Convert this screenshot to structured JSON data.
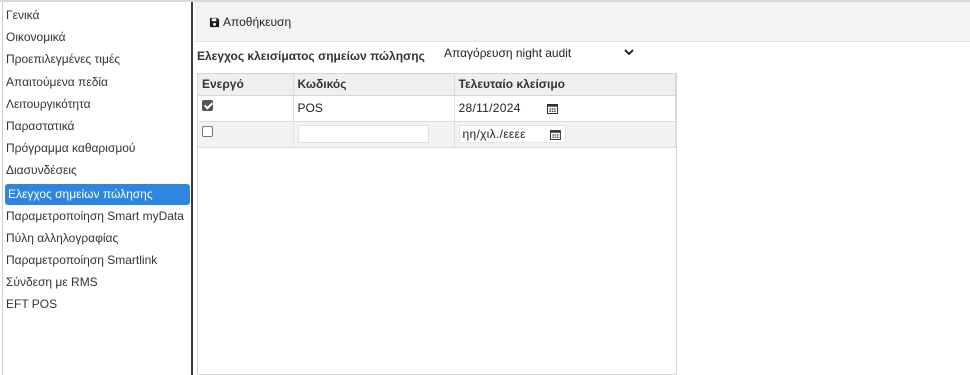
{
  "sidebar": {
    "items": [
      {
        "label": "Γενικά"
      },
      {
        "label": "Οικονομικά"
      },
      {
        "label": "Προεπιλεγμένες τιμές"
      },
      {
        "label": "Απαιτούμενα πεδία"
      },
      {
        "label": "Λειτουργικότητα"
      },
      {
        "label": "Παραστατικά"
      },
      {
        "label": "Πρόγραμμα καθαρισμού"
      },
      {
        "label": "Διασυνδέσεις"
      },
      {
        "label": "Ελεγχος σημείων πώλησης"
      },
      {
        "label": "Παραμετροποίηση Smart myData"
      },
      {
        "label": "Πύλη αλληλογραφίας"
      },
      {
        "label": "Παραμετροποίηση Smartlink"
      },
      {
        "label": "Σύνδεση με RMS"
      },
      {
        "label": "EFT POS"
      }
    ],
    "active_index": 8
  },
  "toolbar": {
    "save_label": "Αποθήκευση",
    "save_icon": "floppy-disk-icon"
  },
  "section": {
    "title": "Ελεγχος κλεισίματος σημείων πώλησης",
    "select_value": "Απαγόρευση night audit"
  },
  "table": {
    "headers": {
      "active": "Ενεργό",
      "code": "Κωδικός",
      "last_close": "Τελευταίο κλείσιμο"
    },
    "rows": [
      {
        "active": true,
        "code": "POS",
        "last_close": "28/11/2024"
      },
      {
        "active": false,
        "code": "",
        "last_close_placeholder": "ηη/χιλ./εεεε"
      }
    ]
  },
  "colors": {
    "active_item": "#2e86de",
    "header_bg": "#efefef",
    "toolbar_bg": "#f3f3f3"
  }
}
